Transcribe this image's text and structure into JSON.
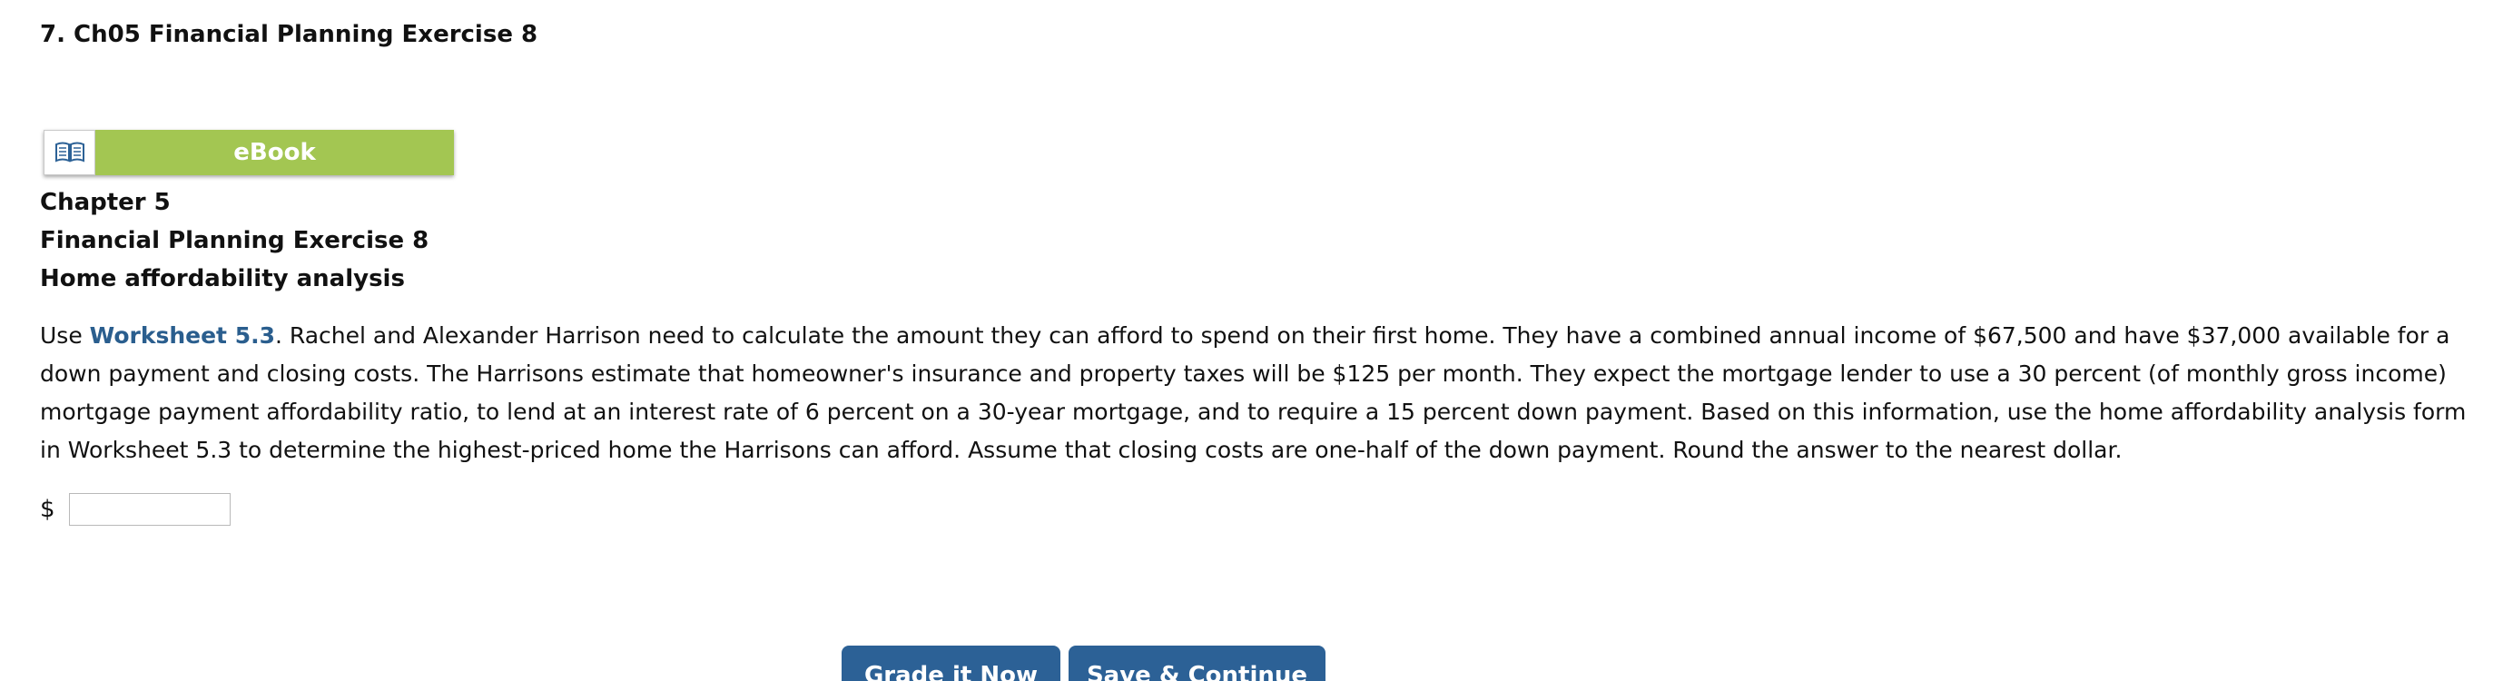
{
  "question": {
    "title": "7.  Ch05 Financial Planning Exercise 8"
  },
  "ebook": {
    "label": "eBook",
    "icon": "book-icon"
  },
  "headings": {
    "chapter": "Chapter 5",
    "exercise": "Financial Planning Exercise 8",
    "topic": "Home affordability analysis"
  },
  "problem": {
    "prefix": "Use ",
    "link_text": "Worksheet 5.3",
    "body": ". Rachel and Alexander Harrison need to calculate the amount they can afford to spend on their first home. They have a combined annual income of $67,500 and have $37,000 available for a down payment and closing costs. The Harrisons estimate that homeowner's insurance and property taxes will be $125 per month. They expect the mortgage lender to use a 30 percent (of monthly gross income) mortgage payment affordability ratio, to lend at an interest rate of 6 percent on a 30-year mortgage, and to require a 15 percent down payment. Based on this information, use the home affordability analysis form in Worksheet 5.3 to determine the highest-priced home the Harrisons can afford. Assume that closing costs are one-half of the down payment. Round the answer to the nearest dollar."
  },
  "answer": {
    "currency_symbol": "$",
    "value": ""
  },
  "buttons": {
    "grade": "Grade it Now",
    "save": "Save & Continue"
  },
  "colors": {
    "ebook_green": "#a3c652",
    "link_blue": "#2a5e8e",
    "button_blue": "#2c6196"
  }
}
